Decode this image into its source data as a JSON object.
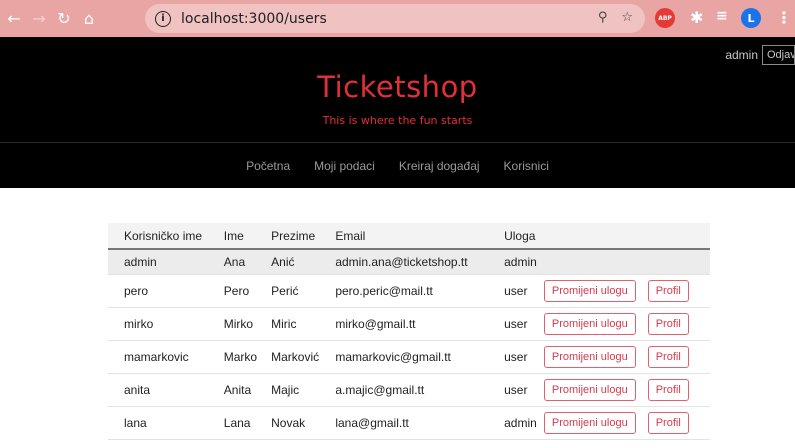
{
  "browser": {
    "url": "localhost:3000/users",
    "avatar_letter": "L",
    "abp_label": "ABP"
  },
  "header": {
    "user_name": "admin",
    "logout_label": "Odjava",
    "title": "Ticketshop",
    "tagline": "This is where the fun starts",
    "nav": [
      "Početna",
      "Moji podaci",
      "Kreiraj događaj",
      "Korisnici"
    ]
  },
  "users_table": {
    "columns": [
      "Korisničko ime",
      "Ime",
      "Prezime",
      "Email",
      "Uloga"
    ],
    "rows": [
      {
        "username": "admin",
        "first": "Ana",
        "last": "Anić",
        "email": "admin.ana@ticketshop.tt",
        "role": "admin"
      },
      {
        "username": "pero",
        "first": "Pero",
        "last": "Perić",
        "email": "pero.peric@mail.tt",
        "role": "user"
      },
      {
        "username": "mirko",
        "first": "Mirko",
        "last": "Miric",
        "email": "mirko@gmail.tt",
        "role": "user"
      },
      {
        "username": "mamarkovic",
        "first": "Marko",
        "last": "Marković",
        "email": "mamarkovic@gmail.tt",
        "role": "user"
      },
      {
        "username": "anita",
        "first": "Anita",
        "last": "Majic",
        "email": "a.majic@gmail.tt",
        "role": "user"
      },
      {
        "username": "lana",
        "first": "Lana",
        "last": "Novak",
        "email": "lana@gmail.tt",
        "role": "admin"
      }
    ],
    "change_role_label": "Promijeni ulogu",
    "profile_label": "Profil"
  },
  "colors": {
    "chrome": "#e8a5a3",
    "accent": "#e0303a",
    "header_bg": "#000000"
  }
}
